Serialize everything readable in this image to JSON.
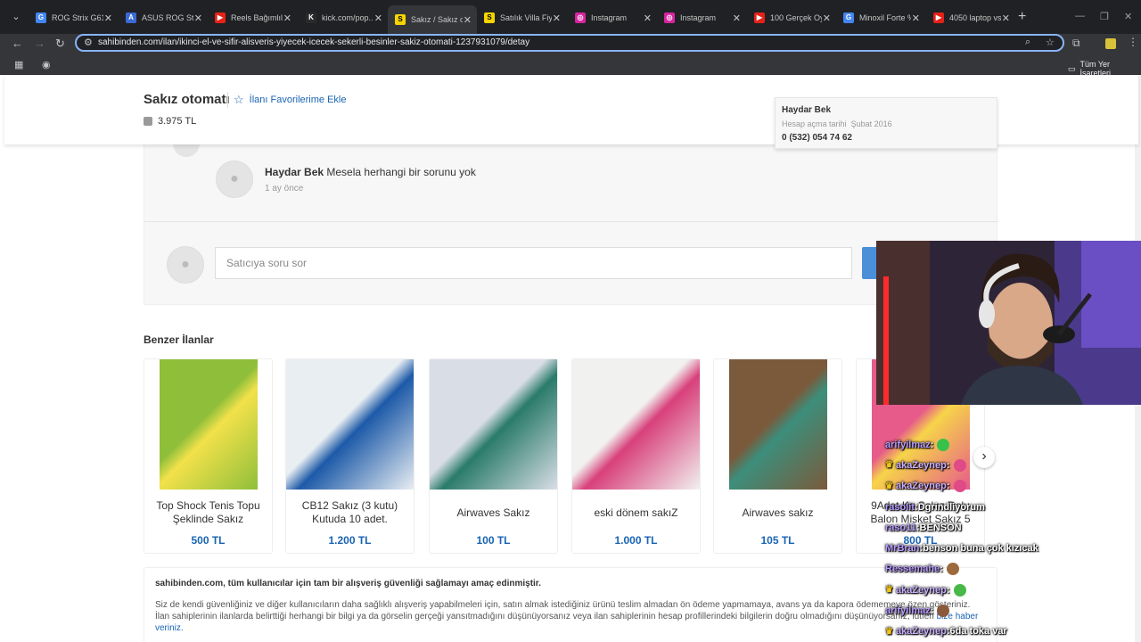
{
  "browser": {
    "tabs": [
      {
        "label": "ROG Strix G614",
        "fav_color": "#4285f4",
        "fav_glyph": "G"
      },
      {
        "label": "ASUS ROG Strix",
        "fav_color": "#3a6ad6",
        "fav_glyph": "A"
      },
      {
        "label": "Reels Bağımlılığı",
        "fav_color": "#e62117",
        "fav_glyph": "▶"
      },
      {
        "label": "kick.com/pop...",
        "fav_color": "#2a2a2a",
        "fav_glyph": "K"
      },
      {
        "label": "Sakız / Sakız ot",
        "fav_color": "#f5d400",
        "fav_glyph": "S",
        "active": true
      },
      {
        "label": "Satılık Villa Fiy",
        "fav_color": "#f5d400",
        "fav_glyph": "S"
      },
      {
        "label": "Instagram",
        "fav_color": "#d6249f",
        "fav_glyph": "◎"
      },
      {
        "label": "Instagram",
        "fav_color": "#d6249f",
        "fav_glyph": "◎"
      },
      {
        "label": "100 Gerçek Oy",
        "fav_color": "#e62117",
        "fav_glyph": "▶"
      },
      {
        "label": "Minoxil Forte %",
        "fav_color": "#4285f4",
        "fav_glyph": "G"
      },
      {
        "label": "4050 laptop vs",
        "fav_color": "#e62117",
        "fav_glyph": "▶"
      }
    ],
    "url": "sahibinden.com/ilan/ikinci-el-ve-sifir-alisveris-yiyecek-icecek-sekerli-besinler-sakiz-otomati-1237931079/detay",
    "bookmarks_all": "Tüm Yer İşaretleri"
  },
  "listing": {
    "title": "Sakız otomatı",
    "favorite_label": "İlanı Favorilerime Ekle",
    "price": "3.975 TL"
  },
  "seller": {
    "name": "Haydar Bek",
    "since_label": "Hesap açma tarihi",
    "since_value": "Şubat 2016",
    "phone": "0 (532) 054 74 62"
  },
  "qa": {
    "author": "Haydar Bek",
    "message": "Mesela herhangi bir sorunu yok",
    "time": "1 ay önce",
    "ask_placeholder": "Satıcıya soru sor"
  },
  "similar": {
    "heading": "Benzer İlanlar",
    "items": [
      {
        "title": "Top Shock Tenis Topu Şeklinde Sakız",
        "price": "500 TL",
        "img_colors": [
          "#8fbf3a",
          "#f2e14a"
        ]
      },
      {
        "title": "CB12 Sakız (3 kutu) Kutuda 10 adet.",
        "price": "1.200 TL",
        "img_colors": [
          "#e9eef3",
          "#1d5aa8"
        ]
      },
      {
        "title": "Airwaves Sakız",
        "price": "100 TL",
        "img_colors": [
          "#d9dee6",
          "#2a7b6a"
        ]
      },
      {
        "title": "eski dönem sakıZ",
        "price": "1.000 TL",
        "img_colors": [
          "#f1f1ef",
          "#d8407a"
        ]
      },
      {
        "title": "Airwaves sakız",
        "price": "105 TL",
        "img_colors": [
          "#7a5a3b",
          "#3c8e7b"
        ]
      },
      {
        "title": "9Adet Kg Sakız Dolu Balon Misket Sakız 5",
        "price": "800 TL",
        "img_colors": [
          "#e65b8a",
          "#f6d44a"
        ]
      }
    ]
  },
  "notice": {
    "heading": "sahibinden.com, tüm kullanıcılar için tam bir alışveriş güvenliği sağlamayı amaç edinmiştir.",
    "body": "Siz de kendi güvenliğiniz ve diğer kullanıcıların daha sağlıklı alışveriş yapabilmeleri için, satın almak istediğiniz ürünü teslim almadan ön ödeme yapmamaya, avans ya da kapora ödememeye özen gösteriniz. İlan sahiplerinin ilanlarda belirttiği herhangi bir bilgi ya da görselin gerçeği yansıtmadığını düşünüyorsanız veya ilan sahiplerinin hesap profillerindeki bilgilerin doğru olmadığını düşünüyorsanız, lütfen",
    "link": "bize haber veriniz."
  },
  "chat": [
    {
      "user": "arifyilmaz",
      "msg": "",
      "crown": false,
      "emote": "#37c14b"
    },
    {
      "user": "akaZeynep",
      "msg": "",
      "crown": true,
      "emote": "#e04a86"
    },
    {
      "user": "akaZeynep",
      "msg": "",
      "crown": true,
      "emote": "#e04a86"
    },
    {
      "user": "rasolit",
      "msg": "Dgrindliyorum",
      "crown": false,
      "emote": ""
    },
    {
      "user": "raso11",
      "msg": "BENSON",
      "crown": false,
      "emote": ""
    },
    {
      "user": "MrBran",
      "msg": "benson buna çok kızıcak",
      "crown": false,
      "emote": ""
    },
    {
      "user": "Ressemahe",
      "msg": "",
      "crown": false,
      "emote": "#9c6a3c"
    },
    {
      "user": "akaZeynep",
      "msg": "",
      "crown": true,
      "emote": "#48b848"
    },
    {
      "user": "arifyilmaz",
      "msg": "",
      "crown": false,
      "emote": "#8b5a3c"
    },
    {
      "user": "akaZeynep",
      "msg": "6da toka var",
      "crown": true,
      "emote": ""
    }
  ]
}
